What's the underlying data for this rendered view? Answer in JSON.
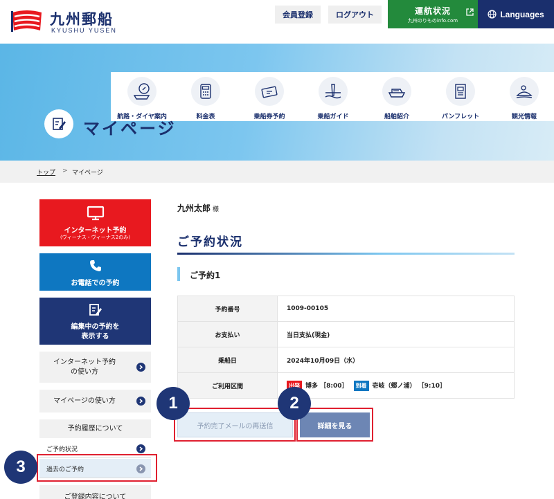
{
  "header": {
    "logo_name": "九州郵船",
    "logo_sub": "KYUSHU YUSEN",
    "member_label": "会員登録",
    "logout_label": "ログアウト",
    "status_main": "運航状況",
    "status_sub": "九州のりものinfo.com",
    "languages_label": "Languages",
    "logo_colors": [
      "#e8191f",
      "#ffffff"
    ]
  },
  "nav": {
    "items": [
      {
        "label": "航路・ダイヤ案内",
        "icon": "compass-ship-icon"
      },
      {
        "label": "料金表",
        "icon": "calculator-icon"
      },
      {
        "label": "乗船券予約",
        "icon": "ticket-icon"
      },
      {
        "label": "乗船ガイド",
        "icon": "pier-guide-icon"
      },
      {
        "label": "船舶紹介",
        "icon": "ship-icon"
      },
      {
        "label": "パンフレット",
        "icon": "pamphlet-icon"
      },
      {
        "label": "観光情報",
        "icon": "island-icon"
      }
    ]
  },
  "page": {
    "title": "マイページ",
    "icon": "edit-note-icon"
  },
  "breadcrumb": {
    "top": "トップ",
    "separator": ">",
    "current": "マイページ"
  },
  "sidebar": {
    "internet_label": "インターネット予約",
    "internet_sub": "(ヴィーナス・ヴィーナス2のみ)",
    "phone_label": "お電話での予約",
    "editing_line1": "編集中の予約を",
    "editing_line2": "表示する",
    "howto_internet_line1": "インターネット予約",
    "howto_internet_line2": "の使い方",
    "howto_mypage": "マイページの使い方",
    "history_head": "予約履歴について",
    "history_items": [
      {
        "label": "ご予約状況",
        "active": false
      },
      {
        "label": "過去のご予約",
        "active": true
      }
    ],
    "registration_head": "ご登録内容について"
  },
  "main": {
    "user_name": "九州太郎",
    "user_suffix": "様",
    "section_title": "ご予約状況",
    "reservation_title": "ご予約1",
    "rows": {
      "number_label": "予約番号",
      "number_value": "1009-00105",
      "payment_label": "お支払い",
      "payment_value": "当日支払(現金)",
      "date_label": "乗船日",
      "date_value": "2024年10月09日（水）",
      "route_label": "ご利用区間",
      "dep_tag": "出発",
      "dep_value": "博多 ［8:00］",
      "arr_tag": "到着",
      "arr_value": "壱岐（郷ノ浦） ［9:10］"
    },
    "resend_label": "予約完了メールの再送信",
    "detail_label": "詳細を見る"
  },
  "annotations": {
    "n1": "1",
    "n2": "2",
    "n3": "3"
  }
}
